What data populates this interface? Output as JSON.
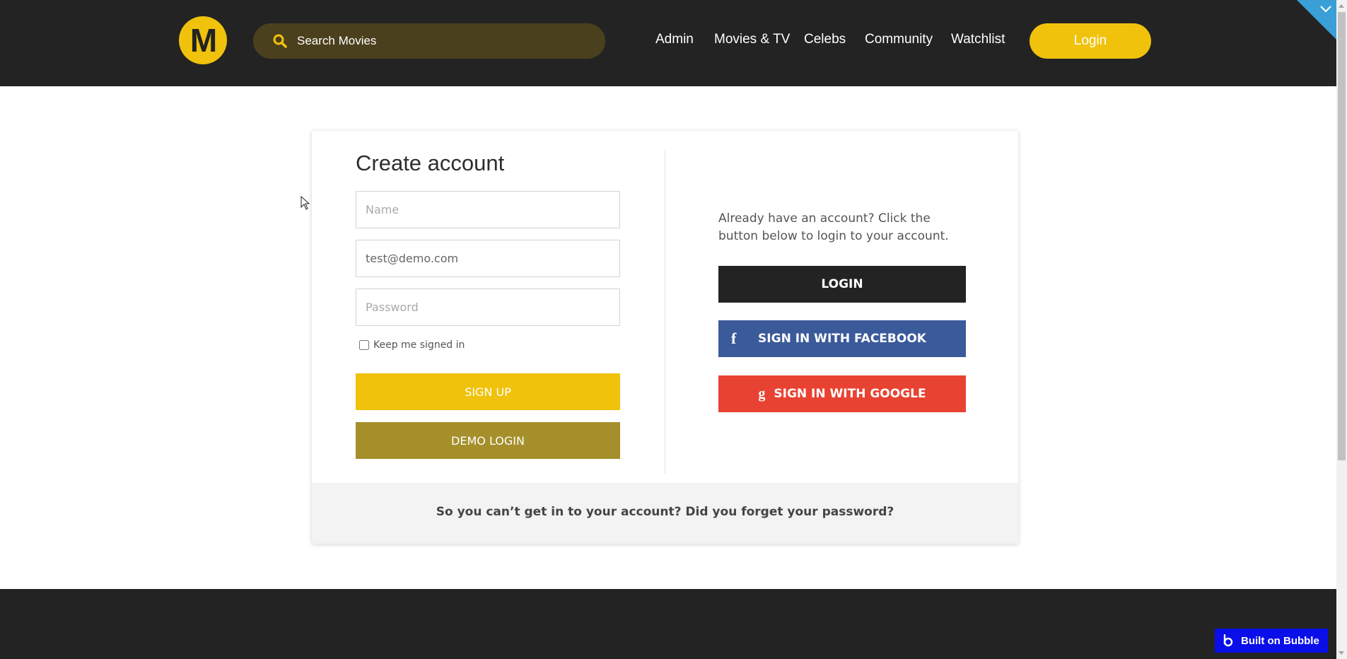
{
  "header": {
    "logo_letter": "M",
    "search_placeholder": "Search Movies",
    "nav": [
      "Admin",
      "Movies & TV",
      "Celebs",
      "Community",
      "Watchlist"
    ],
    "login_label": "Login"
  },
  "signup": {
    "title": "Create account",
    "name_placeholder": "Name",
    "email_value": "test@demo.com",
    "password_placeholder": "Password",
    "keep_signed_in": "Keep me signed in",
    "signup_label": "SIGN UP",
    "demo_label": "DEMO LOGIN"
  },
  "login_panel": {
    "text": "Already have an account? Click the button below to login to your account.",
    "login_label": "LOGIN",
    "facebook_label": "SIGN IN WITH FACEBOOK",
    "google_label": "SIGN IN WITH GOOGLE"
  },
  "forgot": {
    "text": "So you can’t get in to your account? Did you forget your password?"
  },
  "badge": {
    "label": "Built on Bubble"
  },
  "colors": {
    "dark": "#232323",
    "yellow": "#f0c20c",
    "olive": "#a58f2a",
    "facebook": "#3b5a9a",
    "google": "#e84232",
    "bubble": "#0a0ee8"
  }
}
